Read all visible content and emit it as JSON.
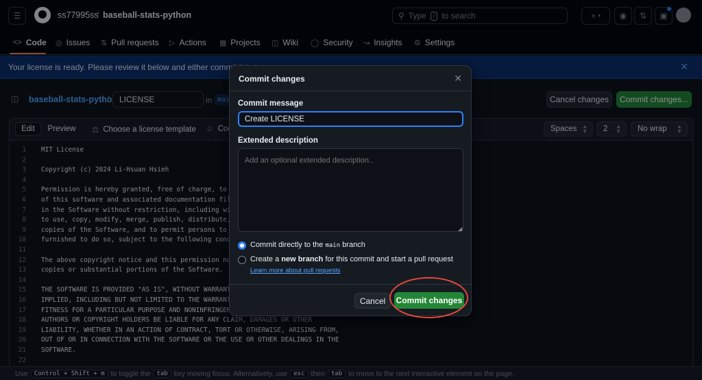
{
  "header": {
    "owner": "ss77995ss",
    "separator": "/",
    "repo": "baseball-stats-python",
    "search_prefix": "Type",
    "search_key": "/",
    "search_suffix": "to search"
  },
  "nav": {
    "tabs": [
      {
        "label": "Code",
        "icon": "code-icon"
      },
      {
        "label": "Issues",
        "icon": "issue-opened-icon"
      },
      {
        "label": "Pull requests",
        "icon": "git-pull-request-icon"
      },
      {
        "label": "Actions",
        "icon": "play-icon"
      },
      {
        "label": "Projects",
        "icon": "table-icon"
      },
      {
        "label": "Wiki",
        "icon": "book-icon"
      },
      {
        "label": "Security",
        "icon": "shield-icon"
      },
      {
        "label": "Insights",
        "icon": "graph-icon"
      },
      {
        "label": "Settings",
        "icon": "gear-icon"
      }
    ]
  },
  "banner": {
    "text": "Your license is ready. Please review it below and either commit it to t"
  },
  "editor_header": {
    "repo_link": "baseball-stats-python",
    "slash": "/",
    "filename": "LICENSE",
    "in_label": "in",
    "branch": "main",
    "cancel_label": "Cancel changes",
    "commit_label": "Commit changes..."
  },
  "editor_toolbar": {
    "edit_label": "Edit",
    "preview_label": "Preview",
    "license_template_label": "Choose a license template",
    "code_label": "Cod",
    "indent_mode": "Spaces",
    "indent_size": "2",
    "wrap_mode": "No wrap"
  },
  "code_lines": [
    {
      "n": "1",
      "t": "MIT License"
    },
    {
      "n": "2",
      "t": ""
    },
    {
      "n": "3",
      "t": "Copyright (c) 2024 Li-Hsuan Hsieh"
    },
    {
      "n": "4",
      "t": ""
    },
    {
      "n": "5",
      "t": "Permission is hereby granted, free of charge, to any"
    },
    {
      "n": "6",
      "t": "of this software and associated documentation files"
    },
    {
      "n": "7",
      "t": "in the Software without restriction, including witho"
    },
    {
      "n": "8",
      "t": "to use, copy, modify, merge, publish, distribute, su"
    },
    {
      "n": "9",
      "t": "copies of the Software, and to permit persons to who"
    },
    {
      "n": "10",
      "t": "furnished to do so, subject to the following conditi"
    },
    {
      "n": "11",
      "t": ""
    },
    {
      "n": "12",
      "t": "The above copyright notice and this permission notic"
    },
    {
      "n": "13",
      "t": "copies or substantial portions of the Software."
    },
    {
      "n": "14",
      "t": ""
    },
    {
      "n": "15",
      "t": "THE SOFTWARE IS PROVIDED \"AS IS\", WITHOUT WARRANTY O"
    },
    {
      "n": "16",
      "t": "IMPLIED, INCLUDING BUT NOT LIMITED TO THE WARRANTIES"
    },
    {
      "n": "17",
      "t": "FITNESS FOR A PARTICULAR PURPOSE AND NONINFRINGEMENT"
    },
    {
      "n": "18",
      "t": "AUTHORS OR COPYRIGHT HOLDERS BE LIABLE FOR ANY CLAIM, DAMAGES OR OTHER"
    },
    {
      "n": "19",
      "t": "LIABILITY, WHETHER IN AN ACTION OF CONTRACT, TORT OR OTHERWISE, ARISING FROM,"
    },
    {
      "n": "20",
      "t": "OUT OF OR IN CONNECTION WITH THE SOFTWARE OR THE USE OR OTHER DEALINGS IN THE"
    },
    {
      "n": "21",
      "t": "SOFTWARE."
    },
    {
      "n": "22",
      "t": ""
    }
  ],
  "footer": {
    "use": "Use",
    "key_combo": "Control + Shift + m",
    "toggle_text": "to toggle the",
    "tab_key": "tab",
    "moving_text": "key moving focus. Alternatively, use",
    "esc_key": "esc",
    "then_text": "then",
    "tab_key2": "tab",
    "rest_text": "to move to the next interactive element on the page."
  },
  "modal": {
    "title": "Commit changes",
    "close_icon": "x-icon",
    "message_label": "Commit message",
    "message_value": "Create LICENSE",
    "description_label": "Extended description",
    "description_placeholder": "Add an optional extended description..",
    "option1_prefix": "Commit directly to the",
    "option1_branch": "main",
    "option1_suffix": "branch",
    "option2_prefix": "Create a",
    "option2_bold": "new branch",
    "option2_suffix": "for this commit and start a pull request",
    "learn_more": "Learn more about pull requests",
    "cancel_label": "Cancel",
    "commit_label": "Commit changes"
  },
  "colors": {
    "accent_green": "#238636",
    "link_blue": "#58a6ff",
    "annotation_red": "#e5483b",
    "tab_underline": "#f78166"
  }
}
